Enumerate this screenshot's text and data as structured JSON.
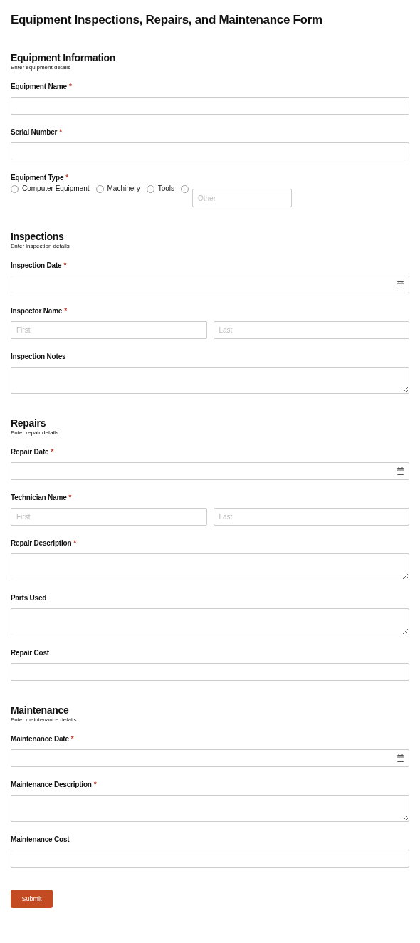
{
  "title": "Equipment Inspections, Repairs, and Maintenance Form",
  "sections": [
    {
      "heading": "Equipment Information",
      "subtitle": "Enter equipment details",
      "fields": [
        {
          "kind": "text",
          "label": "Equipment Name",
          "required_mark": "*"
        },
        {
          "kind": "text",
          "label": "Serial Number",
          "required_mark": "*"
        },
        {
          "kind": "radio",
          "label": "Equipment Type",
          "required_mark": "*",
          "options": [
            {
              "label": "Computer Equipment",
              "selected": false
            },
            {
              "label": "Machinery",
              "selected": false
            },
            {
              "label": "Tools",
              "selected": false
            },
            {
              "placeholder": "Other",
              "selected": false
            }
          ]
        }
      ]
    },
    {
      "heading": "Inspections",
      "subtitle": "Enter inspection details",
      "fields": [
        {
          "kind": "date",
          "label": "Inspection Date",
          "required_mark": "*"
        },
        {
          "kind": "name",
          "label": "Inspector Name",
          "required_mark": "*",
          "first_placeholder": "First",
          "last_placeholder": "Last"
        },
        {
          "kind": "textarea",
          "label": "Inspection Notes"
        }
      ]
    },
    {
      "heading": "Repairs",
      "subtitle": "Enter repair details",
      "fields": [
        {
          "kind": "date",
          "label": "Repair Date",
          "required_mark": "*"
        },
        {
          "kind": "name",
          "label": "Technician Name",
          "required_mark": "*",
          "first_placeholder": "First",
          "last_placeholder": "Last"
        },
        {
          "kind": "textarea",
          "label": "Repair Description",
          "required_mark": "*"
        },
        {
          "kind": "textarea",
          "label": "Parts Used"
        },
        {
          "kind": "text",
          "label": "Repair Cost"
        }
      ]
    },
    {
      "heading": "Maintenance",
      "subtitle": "Enter maintenance details",
      "fields": [
        {
          "kind": "date",
          "label": "Maintenance Date",
          "required_mark": "*"
        },
        {
          "kind": "textarea",
          "label": "Maintenance Description",
          "required_mark": "*"
        },
        {
          "kind": "text",
          "label": "Maintenance Cost"
        }
      ]
    }
  ],
  "submit": "Submit"
}
